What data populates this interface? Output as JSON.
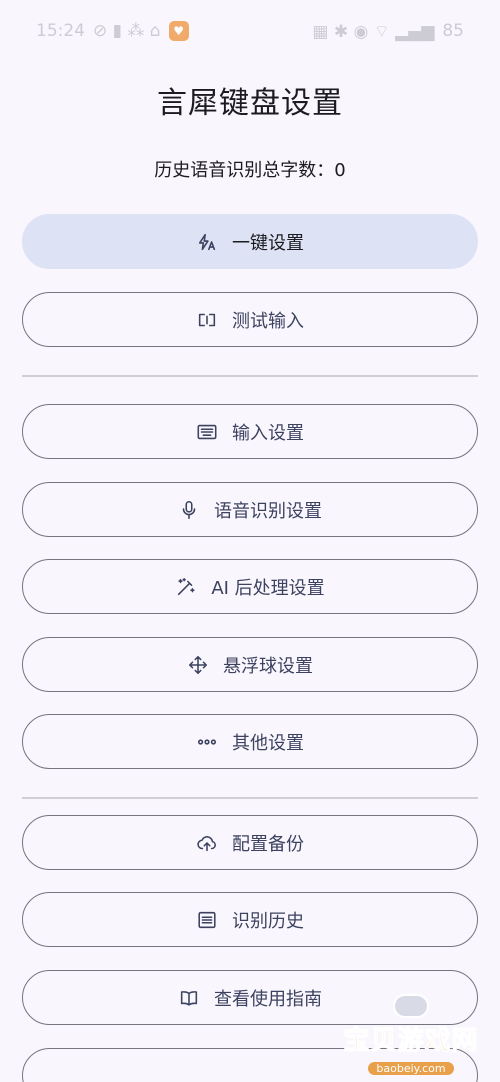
{
  "status_bar": {
    "time": "15:24",
    "battery": "85"
  },
  "title": "言犀键盘设置",
  "stats": {
    "label": "历史语音识别总字数：0"
  },
  "buttons": [
    {
      "label": "一键设置",
      "icon": "auto-magic-icon"
    },
    {
      "label": "测试输入",
      "icon": "input-test-icon"
    },
    {
      "label": "输入设置",
      "icon": "keyboard-icon"
    },
    {
      "label": "语音识别设置",
      "icon": "microphone-icon"
    },
    {
      "label": "AI 后处理设置",
      "icon": "magic-wand-icon"
    },
    {
      "label": "悬浮球设置",
      "icon": "move-arrows-icon"
    },
    {
      "label": "其他设置",
      "icon": "more-dots-icon"
    },
    {
      "label": "配置备份",
      "icon": "cloud-upload-icon"
    },
    {
      "label": "识别历史",
      "icon": "list-icon"
    },
    {
      "label": "查看使用指南",
      "icon": "book-icon"
    }
  ],
  "watermark": {
    "text": "宝贝游戏网",
    "url": "baobeiy.com"
  },
  "colors": {
    "accent_fill": "#dde3f5",
    "outline": "#74757e",
    "background": "#f9f7fd"
  }
}
